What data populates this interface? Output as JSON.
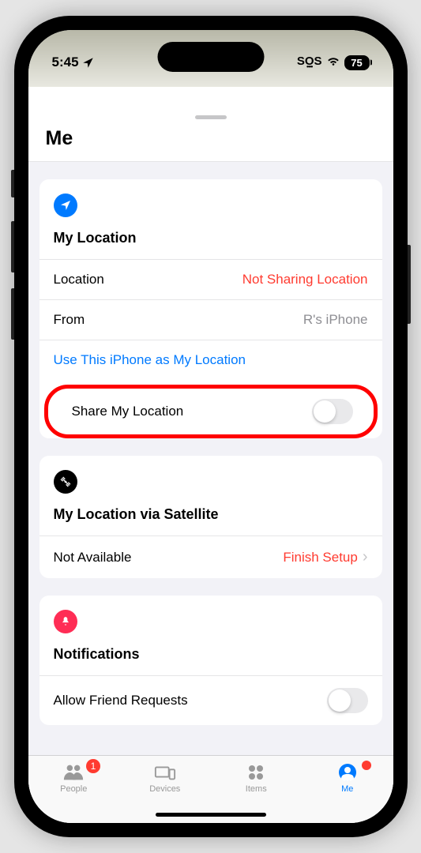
{
  "status_bar": {
    "time": "5:45",
    "sos": "SOS",
    "battery": "75"
  },
  "sheet": {
    "title": "Me"
  },
  "location_section": {
    "header": "My Location",
    "location_label": "Location",
    "location_value": "Not Sharing Location",
    "from_label": "From",
    "from_value": "R's iPhone",
    "use_this_iphone": "Use This iPhone as My Location",
    "share_my_location": "Share My Location"
  },
  "satellite_section": {
    "header": "My Location via Satellite",
    "not_available": "Not Available",
    "finish_setup": "Finish Setup"
  },
  "notifications_section": {
    "header": "Notifications",
    "allow_friend_requests": "Allow Friend Requests"
  },
  "tabs": {
    "people": "People",
    "people_badge": "1",
    "devices": "Devices",
    "items": "Items",
    "me": "Me"
  }
}
